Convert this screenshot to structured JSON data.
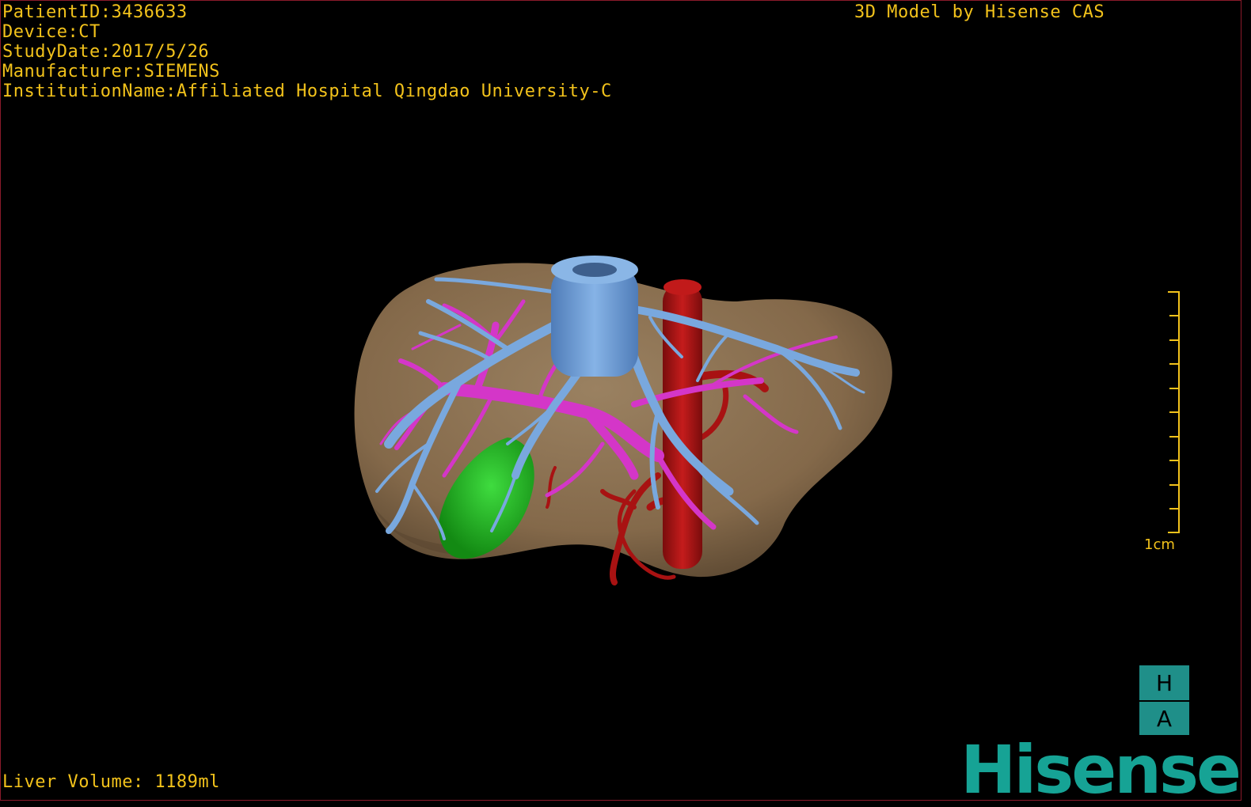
{
  "overlay": {
    "patient_id": "PatientID:3436633",
    "device": "Device:CT",
    "study_date": "StudyDate:2017/5/26",
    "manufacturer": "Manufacturer:SIEMENS",
    "institution": "InstitutionName:Affiliated Hospital Qingdao University-C",
    "credit": "3D Model by Hisense CAS",
    "liver_volume": "Liver Volume: 1189ml"
  },
  "scale_bar": {
    "label": "1cm"
  },
  "orientation": {
    "top": "H",
    "bottom": "A"
  },
  "brand": {
    "logo_text": "Hisense"
  },
  "colors": {
    "background": "#000000",
    "overlay_text": "#f2c21b",
    "liver": "#8a7252",
    "hepatic_veins": "#6f9fd8",
    "portal_vein": "#d436c8",
    "artery_ivc": "#b11515",
    "gallbladder": "#1fb31f",
    "brand": "#16a395"
  }
}
